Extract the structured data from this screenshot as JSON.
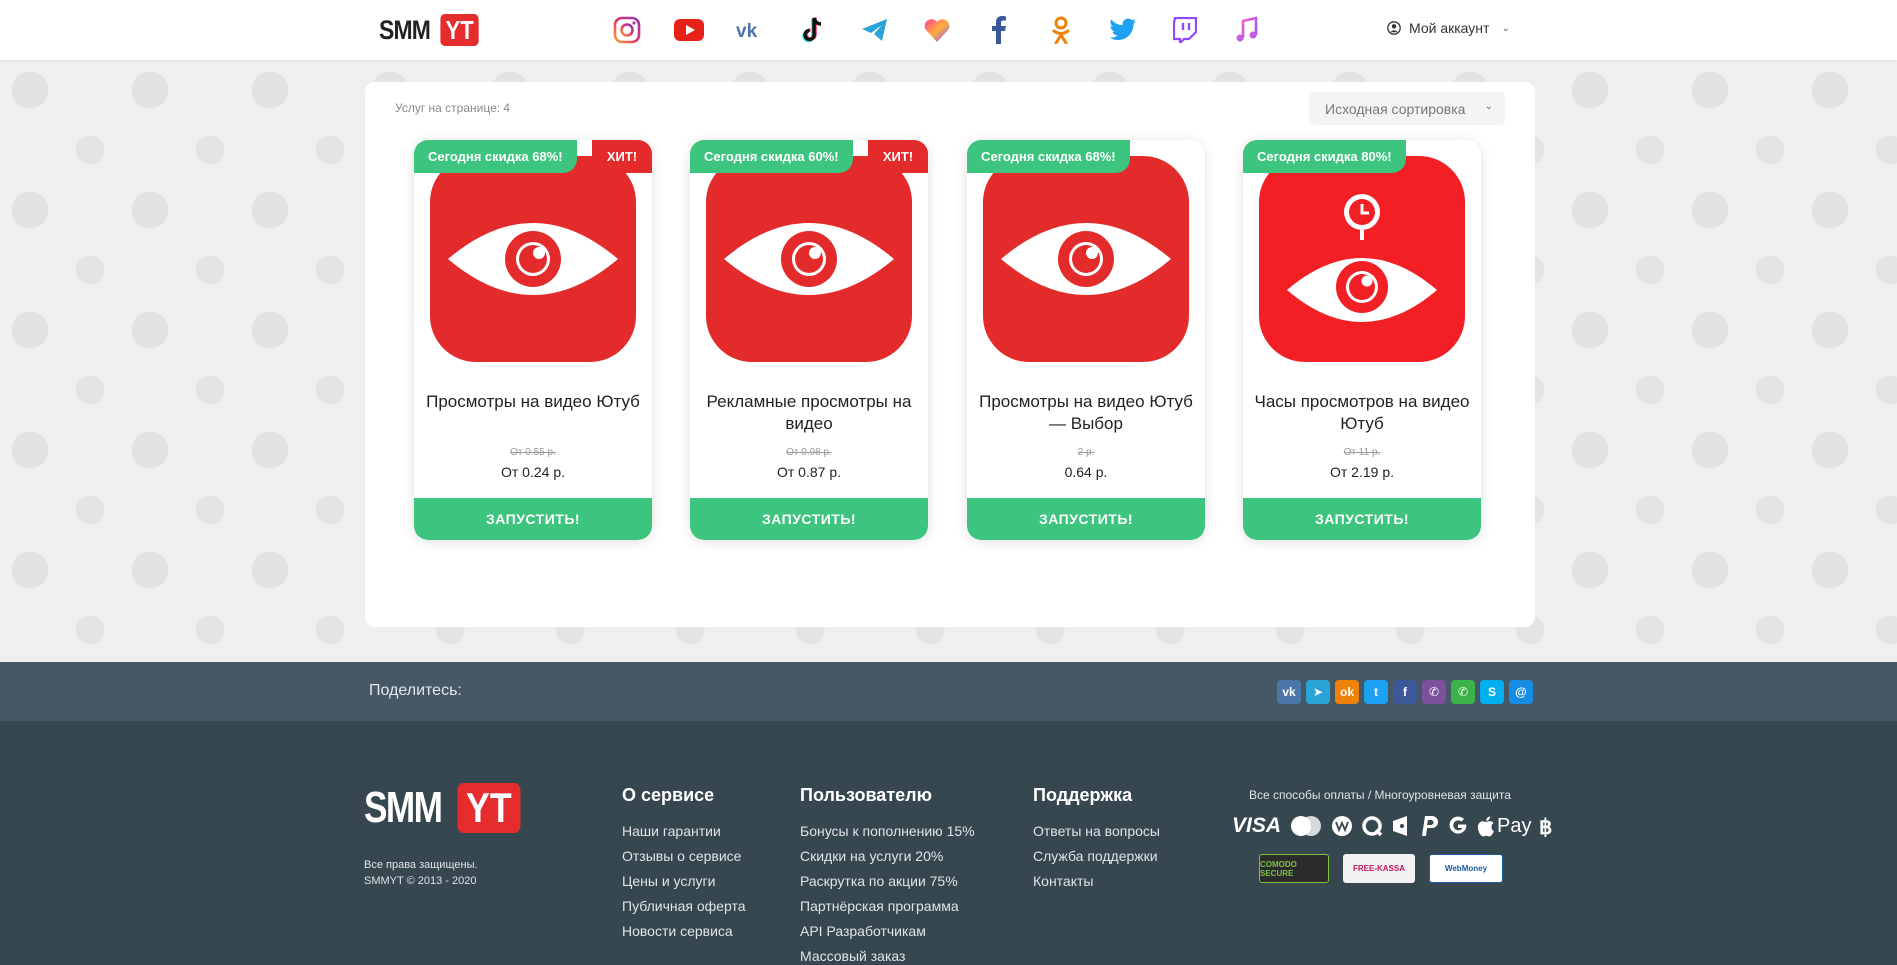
{
  "header": {
    "logo_smm": "SMM",
    "logo_yt": "YT",
    "socials": [
      {
        "name": "instagram-icon"
      },
      {
        "name": "youtube-icon"
      },
      {
        "name": "vk-icon"
      },
      {
        "name": "tiktok-icon"
      },
      {
        "name": "telegram-icon"
      },
      {
        "name": "likee-icon"
      },
      {
        "name": "facebook-icon"
      },
      {
        "name": "odnoklassniki-icon"
      },
      {
        "name": "twitter-icon"
      },
      {
        "name": "twitch-icon"
      },
      {
        "name": "itunes-icon"
      }
    ],
    "account_label": "Мой аккаунт"
  },
  "catalog": {
    "per_page_label": "Услуг на странице: 4",
    "sort_label": "Исходная сортировка",
    "cards": [
      {
        "discount": "Сегодня скидка 68%!",
        "hit": "ХИТ!",
        "title": "Просмотры на видео Ютуб",
        "old_price": "От 0.55 р.",
        "price": "От 0.24  р.",
        "button": "ЗАПУСТИТЬ!"
      },
      {
        "discount": "Сегодня скидка 60%!",
        "hit": "ХИТ!",
        "title": "Рекламные просмотры на видео",
        "old_price": "От 0.98 р.",
        "price": "От 0.87  р.",
        "button": "ЗАПУСТИТЬ!"
      },
      {
        "discount": "Сегодня скидка 68%!",
        "hit": "",
        "title": "Просмотры на видео Ютуб — Выбор",
        "old_price": "2 р.",
        "price": "0.64  р.",
        "button": "ЗАПУСТИТЬ!"
      },
      {
        "discount": "Сегодня скидка 80%!",
        "hit": "",
        "title": "Часы просмотров на видео Ютуб",
        "old_price": "От 11 р.",
        "price": "От 2.19  р.",
        "button": "ЗАПУСТИТЬ!"
      }
    ]
  },
  "share": {
    "label": "Поделитесь:",
    "icons": [
      {
        "name": "vk-share-icon",
        "glyph": "vk",
        "color": "#4a76a8"
      },
      {
        "name": "telegram-share-icon",
        "glyph": "➤",
        "color": "#2aa3d6"
      },
      {
        "name": "ok-share-icon",
        "glyph": "ok",
        "color": "#ee8208"
      },
      {
        "name": "twitter-share-icon",
        "glyph": "t",
        "color": "#1da1f2"
      },
      {
        "name": "facebook-share-icon",
        "glyph": "f",
        "color": "#3b5998"
      },
      {
        "name": "viber-share-icon",
        "glyph": "✆",
        "color": "#7b519d"
      },
      {
        "name": "whatsapp-share-icon",
        "glyph": "✆",
        "color": "#3cb34a"
      },
      {
        "name": "skype-share-icon",
        "glyph": "S",
        "color": "#00aff0"
      },
      {
        "name": "moimir-share-icon",
        "glyph": "@",
        "color": "#168de2"
      }
    ]
  },
  "footer": {
    "logo_smm": "SMM",
    "logo_yt": "YT",
    "rights_line1": "Все права защищены.",
    "rights_line2": "SMMYT © 2013 - 2020",
    "columns": [
      {
        "title": "О сервисе",
        "links": [
          "Наши гарантии",
          "Отзывы о сервисе",
          "Цены и услуги",
          "Публичная оферта",
          "Новости сервиса"
        ]
      },
      {
        "title": "Пользователю",
        "links": [
          "Бонусы к пополнению 15%",
          "Скидки на услуги 20%",
          "Раскрутка по акции 75%",
          "Партнёрская программа",
          "API Разработчикам",
          "Массовый заказ"
        ]
      },
      {
        "title": "Поддержка",
        "links": [
          "Ответы на вопросы",
          "Служба поддержки",
          "Контакты"
        ]
      }
    ],
    "pay_title": "Все способы оплаты / Многоуровневая защита",
    "pay_visa": "VISA",
    "pay_apple": "Pay",
    "badges": [
      "COMODO SECURE",
      "FREE-KASSA",
      "WebMoney"
    ]
  }
}
